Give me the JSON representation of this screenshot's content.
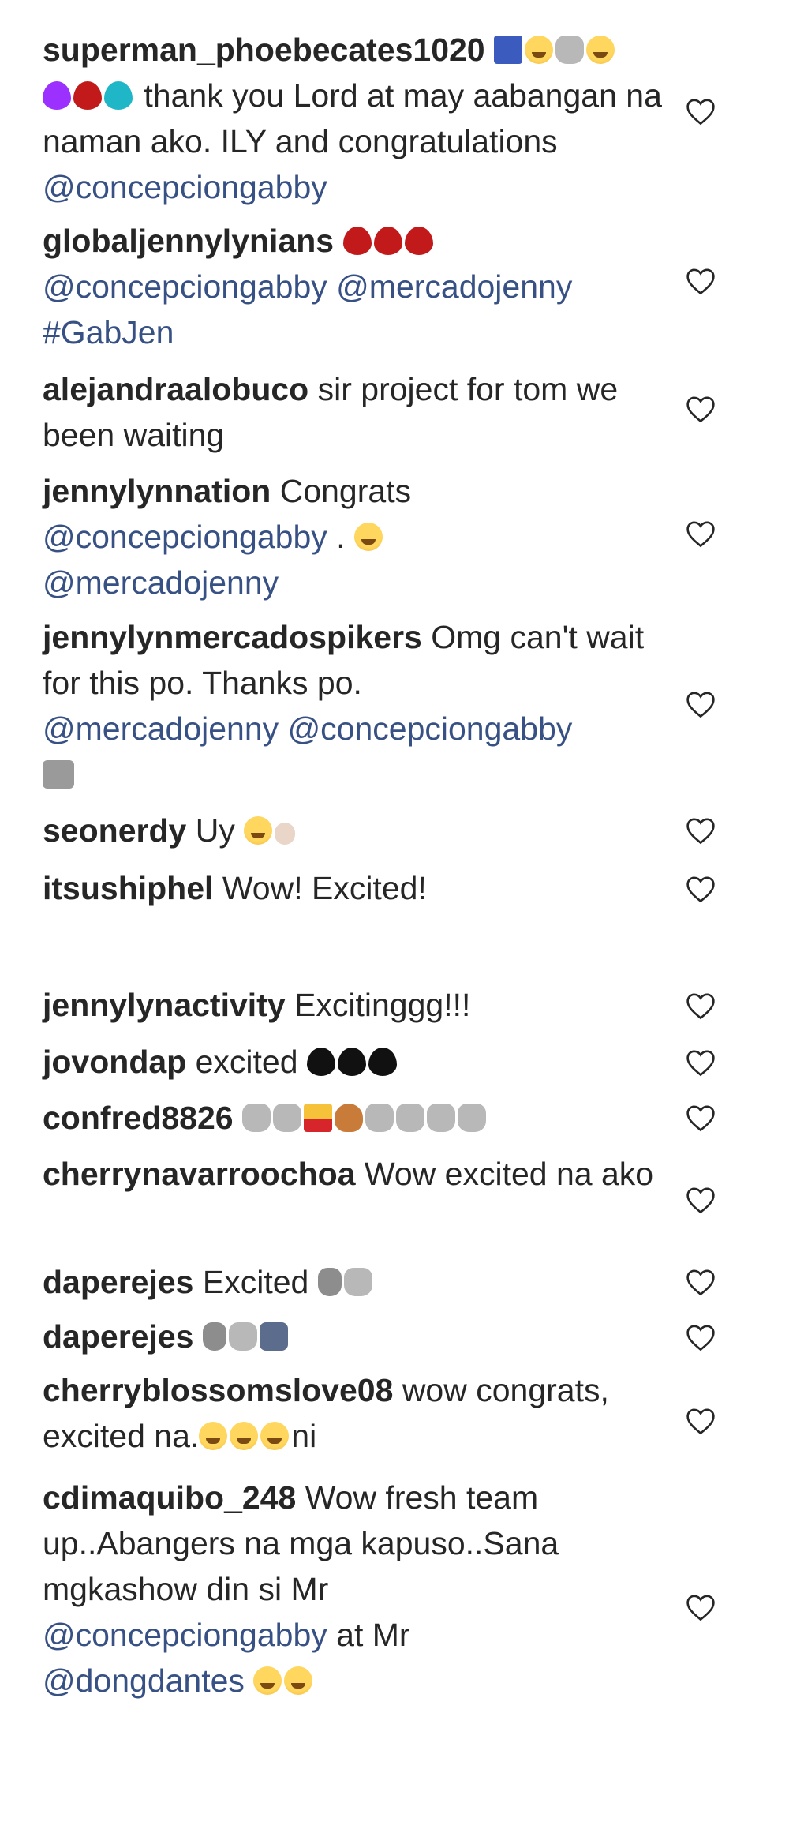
{
  "comments": [
    {
      "user": "superman_phoebecates1020",
      "parts": [
        " thank you Lord at may aabangan na naman ako. ILY and congratulations "
      ],
      "mention": "@concepciongabby"
    },
    {
      "user": "globaljennylynians",
      "mentions": [
        "@concepciongabby",
        "@mercadojenny",
        "#GabJen"
      ]
    },
    {
      "user": "alejandraalobuco",
      "text": "sir project for tom we been waiting"
    },
    {
      "user": "jennylynnation",
      "text": "Congrats",
      "mentions": [
        "@concepciongabby",
        "@mercadojenny"
      ],
      "mid_text": " . "
    },
    {
      "user": "jennylynmercadospikers",
      "text": "Omg can't wait for this po. Thanks po.",
      "mentions": [
        "@mercadojenny",
        "@concepciongabby"
      ]
    },
    {
      "user": "seonerdy",
      "text": "Uy"
    },
    {
      "user": "itsushiphel",
      "text": "Wow! Excited!"
    },
    {
      "user": "jennylynactivity",
      "text": "Excitinggg!!!"
    },
    {
      "user": "jovondap",
      "text": "excited"
    },
    {
      "user": "confred8826",
      "text": ""
    },
    {
      "user": "cherrynavarroochoa",
      "text": "Wow excited na ako"
    },
    {
      "user": "daperejes",
      "text": "Excited"
    },
    {
      "user": "daperejes",
      "text": ""
    },
    {
      "user": "cherryblossomslove08",
      "text": "wow congrats, excited na.",
      "tail": "ni"
    },
    {
      "user": "cdimaquibo_248",
      "text": "Wow fresh team up..Abangers na mga kapuso..Sana mgkashow din si Mr",
      "mentions": [
        "@concepciongabby",
        "@dongdantes"
      ],
      "mid_text": " at Mr"
    }
  ],
  "icons": {
    "like": "heart-outline-icon"
  },
  "colors": {
    "username": "#262626",
    "mention": "#385185",
    "text": "#262626",
    "heart": "#262626"
  }
}
